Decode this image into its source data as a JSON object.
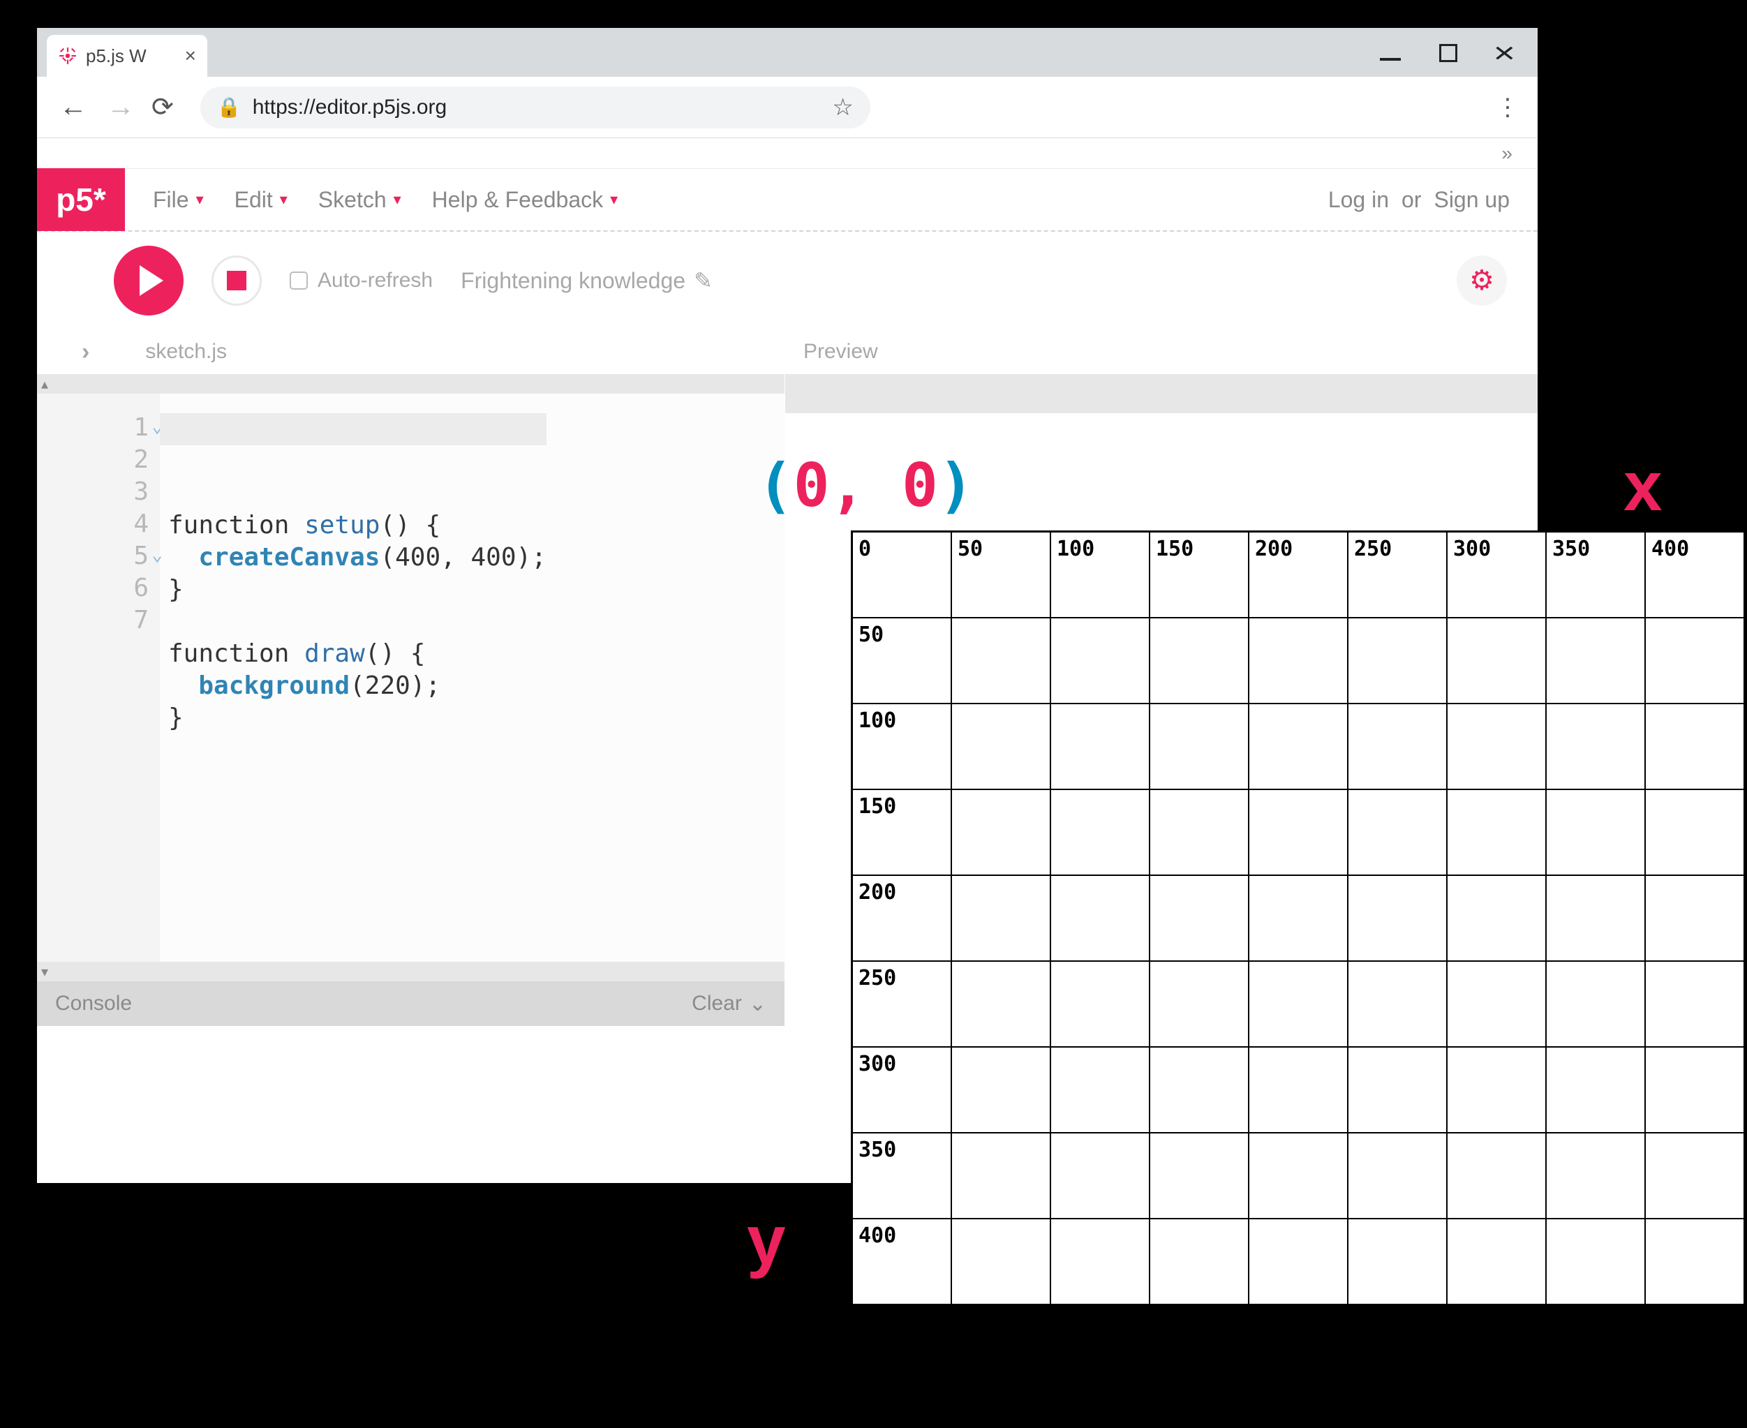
{
  "browser": {
    "tab_title": "p5.js W",
    "url_scheme": "https://",
    "url_rest": "editor.p5js.org"
  },
  "menubar": {
    "logo": "p5*",
    "items": [
      "File",
      "Edit",
      "Sketch",
      "Help & Feedback"
    ],
    "login": "Log in",
    "or": "or",
    "signup": "Sign up"
  },
  "toolbar": {
    "auto_refresh": "Auto-refresh",
    "sketch_name": "Frightening knowledge"
  },
  "files": {
    "current": "sketch.js",
    "preview_label": "Preview"
  },
  "code": {
    "lines": [
      {
        "n": "1",
        "fold": true,
        "html": "<span class='pl'>function </span><span class='kw'>setup</span><span class='pl'>() {</span>"
      },
      {
        "n": "2",
        "fold": false,
        "html": "  <span class='fn'>createCanvas</span><span class='pl'>(400, 400);</span>"
      },
      {
        "n": "3",
        "fold": false,
        "html": "<span class='pl'>}</span>"
      },
      {
        "n": "4",
        "fold": false,
        "html": ""
      },
      {
        "n": "5",
        "fold": true,
        "html": "<span class='pl'>function </span><span class='kw'>draw</span><span class='pl'>() {</span>"
      },
      {
        "n": "6",
        "fold": false,
        "html": "  <span class='fn'>background</span><span class='pl'>(220);</span>"
      },
      {
        "n": "7",
        "fold": false,
        "html": "<span class='pl'>}</span>"
      }
    ]
  },
  "console": {
    "label": "Console",
    "clear": "Clear"
  },
  "overlay": {
    "origin": {
      "open": "(",
      "z1": "0",
      "comma": ", ",
      "z2": "0",
      "close": ")"
    },
    "x_label": "x",
    "y_label": "y",
    "ticks": [
      "0",
      "50",
      "100",
      "150",
      "200",
      "250",
      "300",
      "350",
      "400"
    ]
  }
}
